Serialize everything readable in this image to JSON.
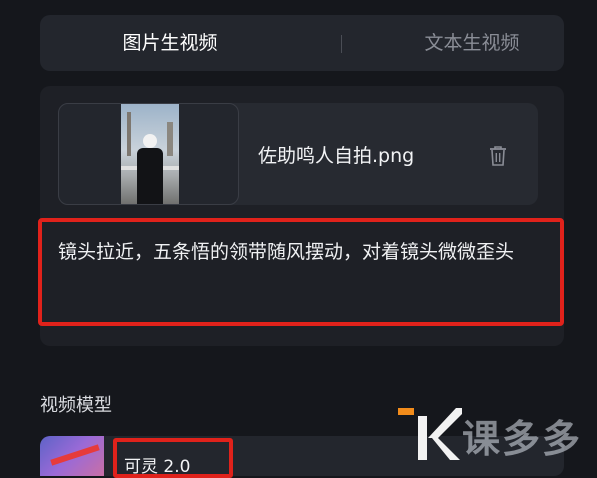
{
  "tabs": [
    {
      "label": "图片生视频",
      "active": true
    },
    {
      "label": "文本生视频",
      "active": false
    }
  ],
  "upload": {
    "file_name": "佐助鸣人自拍.png",
    "delete_icon": "trash-icon"
  },
  "prompt": {
    "text": "镜头拉近，五条悟的领带随风摆动，对着镜头微微歪头"
  },
  "video_model": {
    "section_title": "视频模型",
    "selected_model": "可灵 2.0"
  },
  "watermark": {
    "text": "课多多"
  },
  "colors": {
    "highlight": "#e0221b",
    "background": "#15171c",
    "accent_orange": "#f28c1b"
  }
}
